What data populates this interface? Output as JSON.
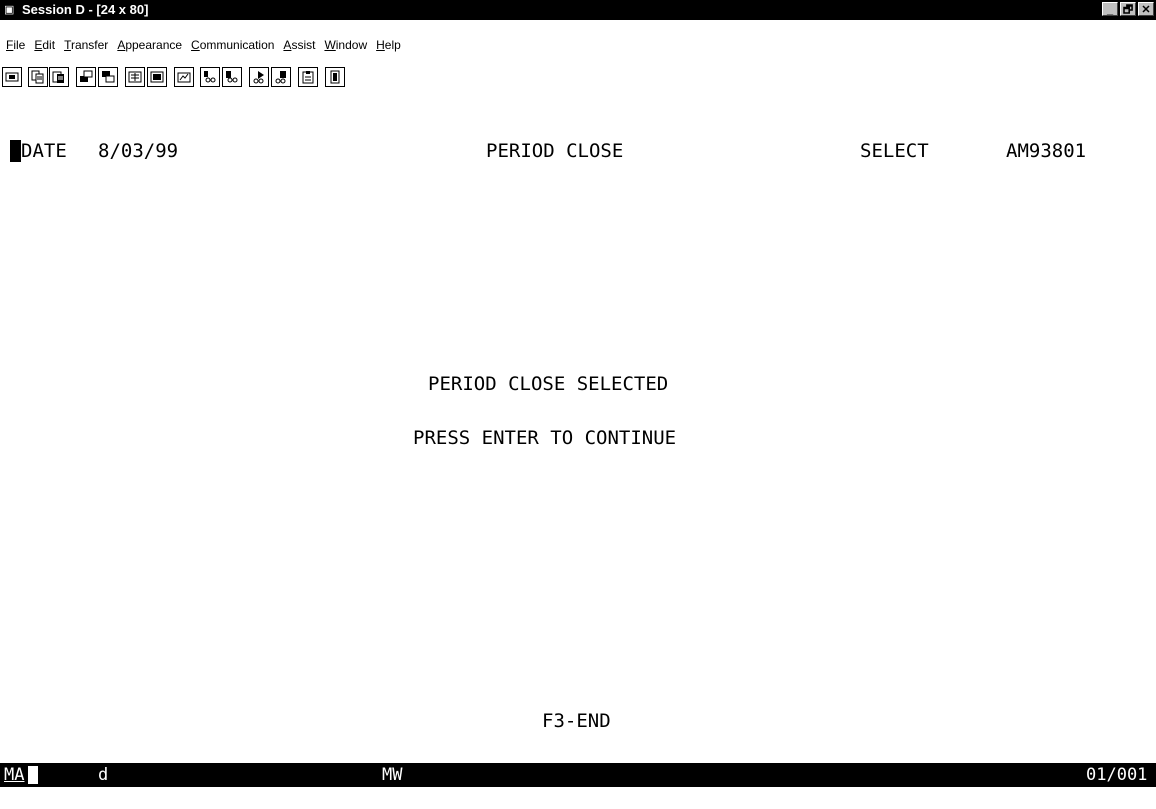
{
  "window": {
    "title": "Session D - [24 x 80]",
    "controls": {
      "minimize": "_",
      "maximize": "🗗",
      "close": "✕"
    }
  },
  "menu": {
    "items": [
      "File",
      "Edit",
      "Transfer",
      "Appearance",
      "Communication",
      "Assist",
      "Window",
      "Help"
    ]
  },
  "toolbar": {
    "icons": [
      "print-screen-icon",
      "copy-icon",
      "paste-icon",
      "send-file-icon",
      "receive-file-icon",
      "keypad-icon",
      "display-icon",
      "macro-icon",
      "record-macro-icon",
      "play-macro-icon",
      "start-icon",
      "stop-icon",
      "clipboard-icon",
      "exit-icon"
    ]
  },
  "terminal": {
    "date_label": "DATE",
    "date_value": "8/03/99",
    "screen_title": "PERIOD CLOSE",
    "mode_label": "SELECT",
    "program_id": "AM93801",
    "message_line1": "PERIOD CLOSE SELECTED",
    "message_line2": "PRESS ENTER TO CONTINUE",
    "function_key": "F3-END"
  },
  "status": {
    "indicator1": "MA",
    "indicator2": "d",
    "indicator3": "MW",
    "cursor_position": "01/001"
  },
  "colors": {
    "background": "#ffffff",
    "text": "#000000",
    "bars": "#000000"
  }
}
